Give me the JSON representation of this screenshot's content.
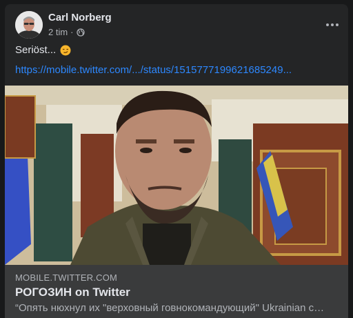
{
  "post": {
    "author": "Carl Norberg",
    "time": "2 tim",
    "separator": "·",
    "text": "Seriöst...",
    "emoji_icon": "smirking-face-emoji",
    "link": "https://mobile.twitter.com/.../status/1515777199621685249..."
  },
  "card": {
    "domain": "MOBILE.TWITTER.COM",
    "title": "РОГОЗИН on Twitter",
    "description": "“Опять нюхнул их \"верховный говнокомандующий\" Ukrainian c…"
  },
  "colors": {
    "background": "#18191a",
    "card": "#242526",
    "footer": "#3a3b3c",
    "link": "#2d88ff",
    "text": "#e4e6eb",
    "secondary": "#b0b3b8"
  }
}
